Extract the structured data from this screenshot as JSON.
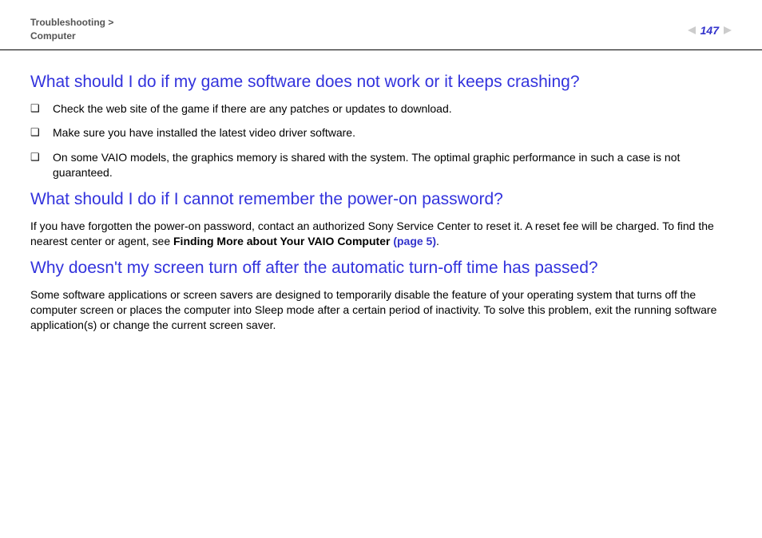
{
  "header": {
    "breadcrumb_line1": "Troubleshooting >",
    "breadcrumb_line2": "Computer",
    "page_number": "147"
  },
  "sections": {
    "s1": {
      "heading": "What should I do if my game software does not work or it keeps crashing?",
      "bullets": [
        "Check the web site of the game if there are any patches or updates to download.",
        "Make sure you have installed the latest video driver software.",
        "On some VAIO models, the graphics memory is shared with the system. The optimal graphic performance in such a case is not guaranteed."
      ]
    },
    "s2": {
      "heading": "What should I do if I cannot remember the power-on password?",
      "text_pre": "If you have forgotten the power-on password, contact an authorized Sony Service Center to reset it. A reset fee will be charged. To find the nearest center or agent, see ",
      "bold": "Finding More about Your VAIO Computer ",
      "link": "(page 5)",
      "text_post": "."
    },
    "s3": {
      "heading": "Why doesn't my screen turn off after the automatic turn-off time has passed?",
      "text": "Some software applications or screen savers are designed to temporarily disable the feature of your operating system that turns off the computer screen or places the computer into Sleep mode after a certain period of inactivity. To solve this problem, exit the running software application(s) or change the current screen saver."
    }
  }
}
